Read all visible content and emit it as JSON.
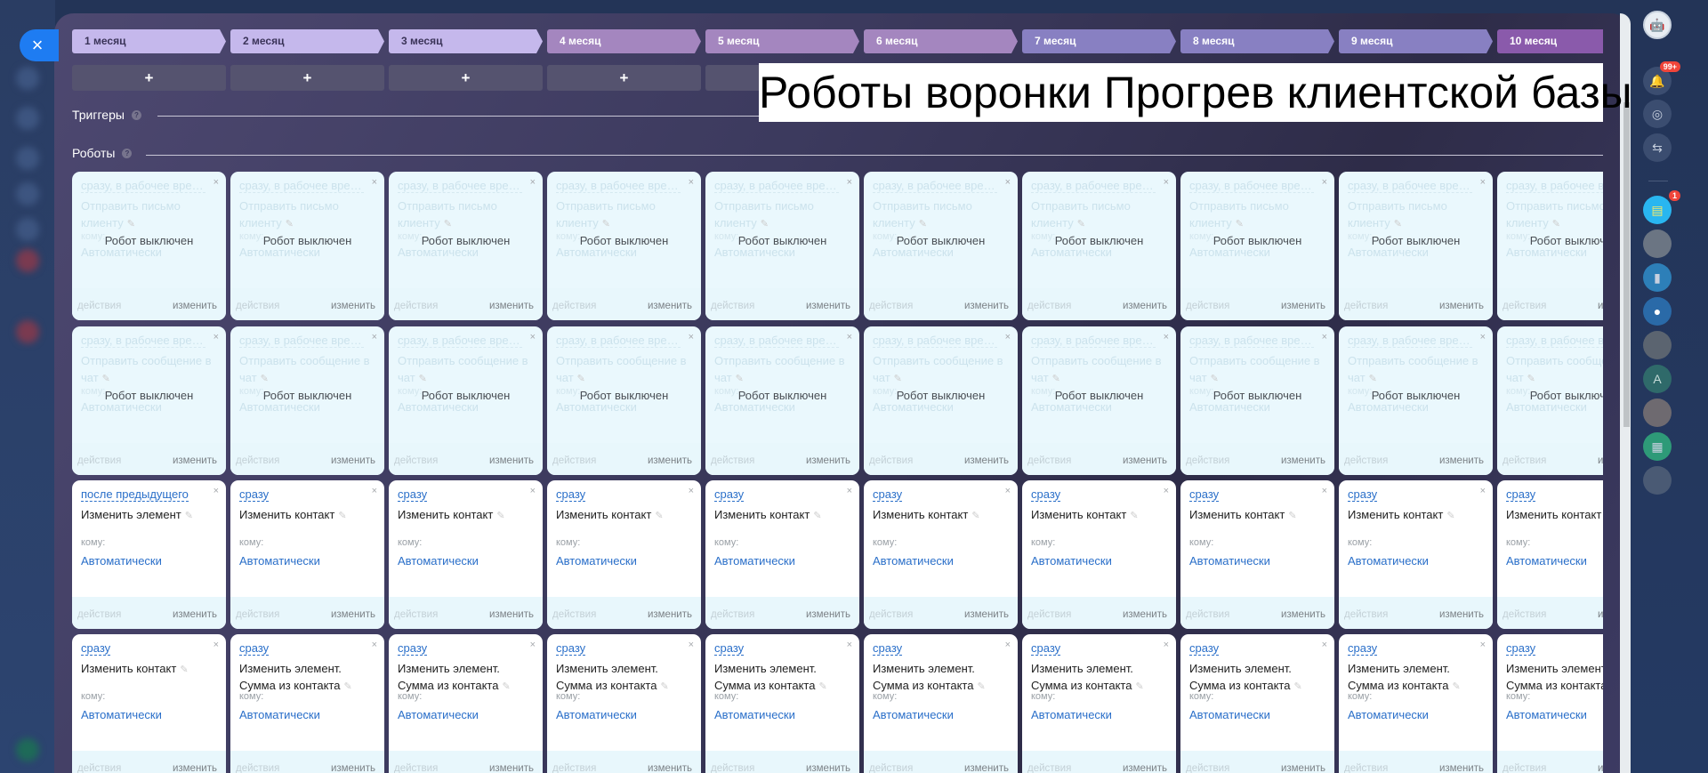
{
  "page_title": "Роботы воронки Прогрев клиентской базы",
  "close_label": "×",
  "sections": {
    "triggers": "Триггеры",
    "robots": "Роботы",
    "help": "?"
  },
  "add_label": "+",
  "stages": [
    {
      "name": "1 месяц",
      "color": "#c5b8ec"
    },
    {
      "name": "2 месяц",
      "color": "#c5b8ec"
    },
    {
      "name": "3 месяц",
      "color": "#c5b8ec"
    },
    {
      "name": "4 месяц",
      "color": "#a486bf"
    },
    {
      "name": "5 месяц",
      "color": "#a486bf"
    },
    {
      "name": "6 месяц",
      "color": "#a486bf"
    },
    {
      "name": "7 месяц",
      "color": "#8880c2"
    },
    {
      "name": "8 месяц",
      "color": "#8880c2"
    },
    {
      "name": "9 месяц",
      "color": "#8880c2"
    },
    {
      "name": "10 месяц",
      "color": "#8a5aab"
    }
  ],
  "card_labels": {
    "close": "×",
    "to": "кому:",
    "who": "Автоматически",
    "actions": "действия",
    "edit": "изменить",
    "disabled": "Робот выключен",
    "pen": "✎"
  },
  "robot_rows": [
    {
      "disabled": true,
      "delay": "сразу, в рабочее время",
      "title": "Отправить письмо клиенту"
    },
    {
      "disabled": true,
      "delay": "сразу, в рабочее время",
      "title": "Отправить сообщение в чат"
    },
    {
      "disabled": false,
      "delay": "сразу",
      "title": "Изменить контакт",
      "first": {
        "delay": "после предыдущего",
        "title": "Изменить элемент"
      }
    },
    {
      "disabled": false,
      "delay": "сразу",
      "title": "Изменить элемент. Сумма из контакта",
      "first": {
        "delay": "сразу",
        "title": "Изменить контакт"
      }
    }
  ],
  "right_sidebar": {
    "notifications_badge": "99+",
    "chat_badge": "1",
    "contact_initial": "A"
  }
}
